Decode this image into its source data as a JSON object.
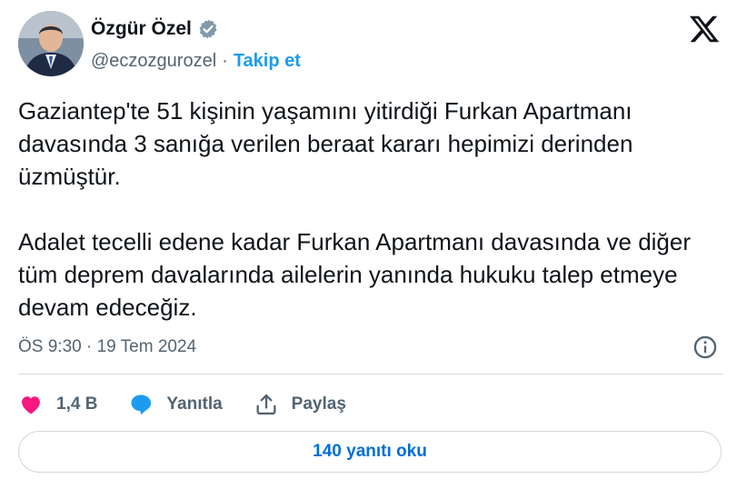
{
  "author": {
    "name": "Özgür Özel",
    "handle": "@eczozgurozel",
    "follow_label": "Takip et",
    "separator": "·",
    "verified_color": "#829aab"
  },
  "icons": {
    "brand": "x-logo-icon",
    "verified": "verified-badge-icon",
    "info": "info-icon",
    "like": "heart-icon",
    "reply": "speech-bubble-icon",
    "share": "share-upload-icon"
  },
  "tweet": {
    "text": "Gaziantep'te 51 kişinin yaşamını yitirdiği Furkan Apartmanı davasında 3 sanığa verilen beraat kararı hepimizi derinden üzmüştür.\n\nAdalet tecelli edene kadar Furkan Apartmanı davasında ve diğer tüm deprem davalarında ailelerin yanında hukuku talep etmeye devam edeceğiz.",
    "timestamp": "ÖS 9:30 · 19 Tem 2024"
  },
  "actions": {
    "like_count": "1,4 B",
    "reply_label": "Yanıtla",
    "share_label": "Paylaş"
  },
  "replies_button": {
    "label": "140 yanıtı oku"
  },
  "colors": {
    "like": "#f91880",
    "link": "#1d9bf0",
    "reply_icon": "#1d9bf0",
    "muted": "#536471",
    "border": "#cfd9de"
  }
}
